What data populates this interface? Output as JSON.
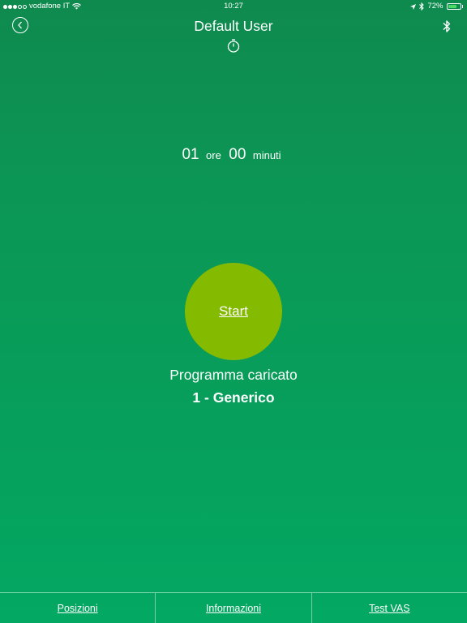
{
  "status_bar": {
    "carrier": "vodafone IT",
    "time": "10:27",
    "battery_percent": "72%",
    "battery_level": 0.72,
    "icons": [
      "signal-dots-icon",
      "wifi-icon",
      "location-arrow-icon",
      "bluetooth-icon",
      "battery-icon"
    ]
  },
  "nav": {
    "title": "Default User",
    "left_icon": "back-chevron-icon",
    "right_icon": "bluetooth-icon",
    "subtitle_icon": "timer-icon"
  },
  "timer": {
    "hours": "01",
    "hours_unit": "ore",
    "minutes": "00",
    "minutes_unit": "minuti"
  },
  "start_button": {
    "label": "Start",
    "color": "#84ba00"
  },
  "program": {
    "label": "Programma caricato",
    "name": "1 - Generico"
  },
  "tabs": [
    {
      "label": "Posizioni"
    },
    {
      "label": "Informazioni"
    },
    {
      "label": "Test VAS"
    }
  ],
  "colors": {
    "background_top": "#0f8a4f",
    "background_bottom": "#03a862",
    "accent_button": "#84ba00",
    "text": "#ffffff"
  }
}
